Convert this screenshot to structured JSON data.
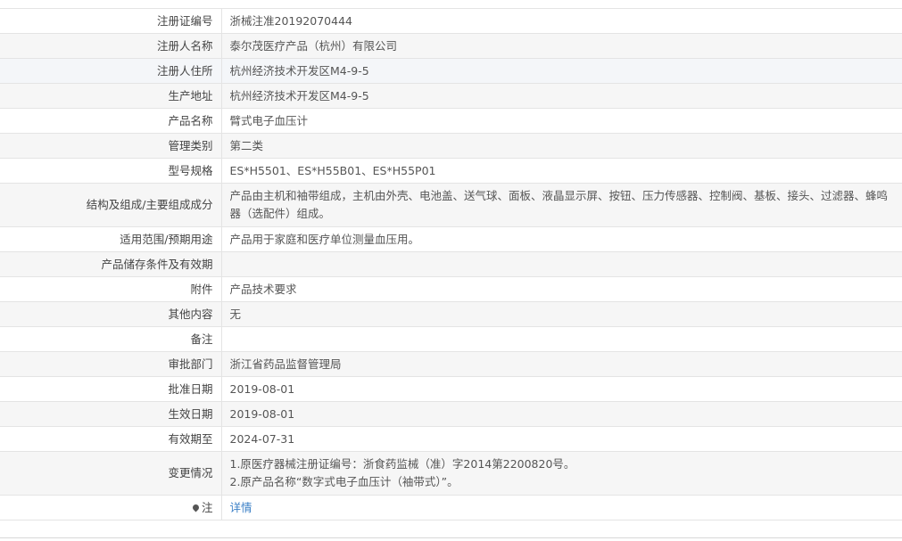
{
  "rows": [
    {
      "label": "注册证编号",
      "value": "浙械注准20192070444"
    },
    {
      "label": "注册人名称",
      "value": "泰尔茂医疗产品（杭州）有限公司"
    },
    {
      "label": "注册人住所",
      "value": "杭州经济技术开发区M4-9-5"
    },
    {
      "label": "生产地址",
      "value": "杭州经济技术开发区M4-9-5"
    },
    {
      "label": "产品名称",
      "value": "臂式电子血压计"
    },
    {
      "label": "管理类别",
      "value": "第二类"
    },
    {
      "label": "型号规格",
      "value": "ES*H5501、ES*H55B01、ES*H55P01"
    },
    {
      "label": "结构及组成/主要组成成分",
      "value": "产品由主机和袖带组成，主机由外壳、电池盖、送气球、面板、液晶显示屏、按钮、压力传感器、控制阀、基板、接头、过滤器、蜂鸣器（选配件）组成。"
    },
    {
      "label": "适用范围/预期用途",
      "value": "产品用于家庭和医疗单位测量血压用。"
    },
    {
      "label": "产品储存条件及有效期",
      "value": ""
    },
    {
      "label": "附件",
      "value": "产品技术要求"
    },
    {
      "label": "其他内容",
      "value": "无"
    },
    {
      "label": "备注",
      "value": ""
    },
    {
      "label": "审批部门",
      "value": "浙江省药品监督管理局"
    },
    {
      "label": "批准日期",
      "value": "2019-08-01"
    },
    {
      "label": "生效日期",
      "value": "2019-08-01"
    },
    {
      "label": "有效期至",
      "value": "2024-07-31"
    },
    {
      "label": "变更情况",
      "lines": [
        "1.原医疗器械注册证编号：浙食药监械（准）字2014第2200820号。",
        "2.原产品名称“数字式电子血压计（袖带式）”。"
      ]
    }
  ],
  "note": {
    "label": "注",
    "link_text": "详情",
    "icon": "pin-icon"
  }
}
